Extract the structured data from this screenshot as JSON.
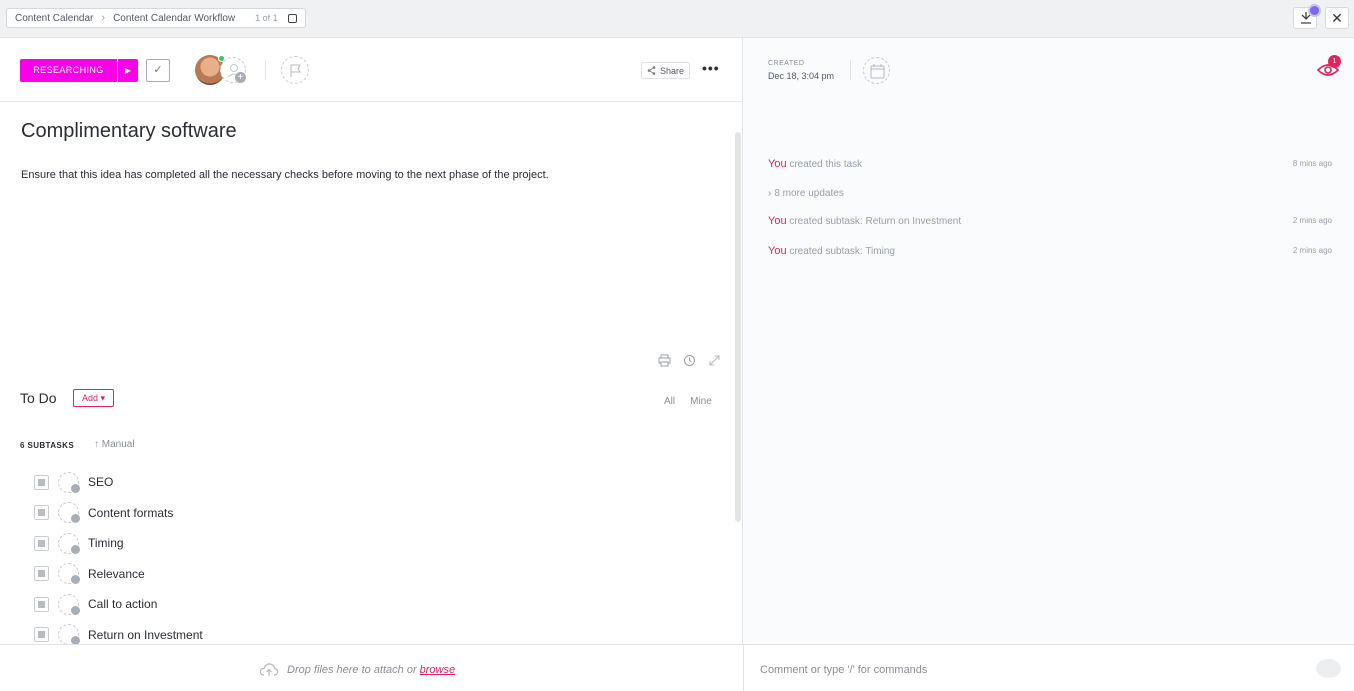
{
  "breadcrumb": {
    "items": [
      "Content Calendar",
      "Content Calendar Workflow"
    ],
    "page_count": "1 of 1"
  },
  "task": {
    "status_label": "RESEARCHING",
    "status_color": "#f900ea",
    "share_label": "Share",
    "title": "Complimentary software",
    "description": "Ensure that this idea has completed all the necessary checks before moving to the next phase of the project."
  },
  "subtasks_section": {
    "heading": "To Do",
    "add_label": "Add",
    "filter_all": "All",
    "filter_mine": "Mine",
    "count_label": "6 SUBTASKS",
    "sort_label": "Manual",
    "items": [
      "SEO",
      "Content formats",
      "Timing",
      "Relevance",
      "Call to action",
      "Return on Investment"
    ]
  },
  "details": {
    "created_label": "CREATED",
    "created_value": "Dec 18, 3:04 pm",
    "watchers_count": "1"
  },
  "activity": [
    {
      "actor": "You",
      "text": " created this task",
      "time": "8 mins ago"
    },
    {
      "actor": "",
      "text": "8 more updates",
      "time": ""
    },
    {
      "actor": "You",
      "text": " created subtask: Return on Investment",
      "time": "2 mins ago"
    },
    {
      "actor": "You",
      "text": " created subtask: Timing",
      "time": "2 mins ago"
    }
  ],
  "footer": {
    "drop_text": "Drop files here to attach or",
    "browse_label": "browse",
    "comment_placeholder": "Comment or type '/' for commands"
  },
  "colors": {
    "accent": "#e0235f",
    "status": "#f900ea",
    "online": "#2ecd6f"
  }
}
